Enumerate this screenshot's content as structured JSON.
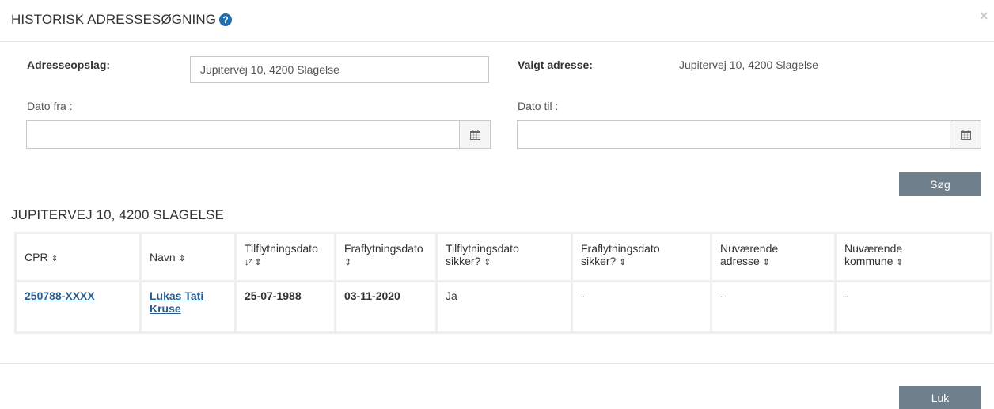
{
  "header": {
    "title": "HISTORISK ADRESSESØGNING",
    "help_icon": "question-circle",
    "close_icon": "×"
  },
  "form": {
    "lookup_label": "Adresseopslag:",
    "lookup_value": "Jupitervej 10, 4200 Slagelse",
    "selected_label": "Valgt adresse:",
    "selected_value": "Jupitervej 10, 4200 Slagelse",
    "date_from_label": "Dato fra :",
    "date_from_value": "",
    "date_to_label": "Dato til :",
    "date_to_value": "",
    "search_button": "Søg"
  },
  "results": {
    "title": "JUPITERVEJ 10, 4200 SLAGELSE",
    "columns": [
      {
        "line1": "CPR",
        "line2": ""
      },
      {
        "line1": "Navn",
        "line2": ""
      },
      {
        "line1": "Tilflytningsdato",
        "line2": ""
      },
      {
        "line1": "Fraflytningsdato",
        "line2": ""
      },
      {
        "line1": "Tilflytningsdato",
        "line2": "sikker?"
      },
      {
        "line1": "Fraflytningsdato",
        "line2": "sikker?"
      },
      {
        "line1": "Nuværende",
        "line2": "adresse"
      },
      {
        "line1": "Nuværende",
        "line2": "kommune"
      }
    ],
    "rows": [
      {
        "cpr": "250788-XXXX",
        "navn_line1": "Lukas Tati",
        "navn_line2": "Kruse",
        "tilflytningsdato": "25-07-1988",
        "fraflytningsdato": "03-11-2020",
        "tilflytning_sikker": "Ja",
        "fraflytning_sikker": "-",
        "nuvaerende_adresse": "-",
        "nuvaerende_kommune": "-"
      }
    ]
  },
  "footer": {
    "close_button": "Luk"
  },
  "colors": {
    "button_bg": "#6f7f8c",
    "link": "#2a5d8f",
    "help_icon": "#1f6fb2"
  }
}
